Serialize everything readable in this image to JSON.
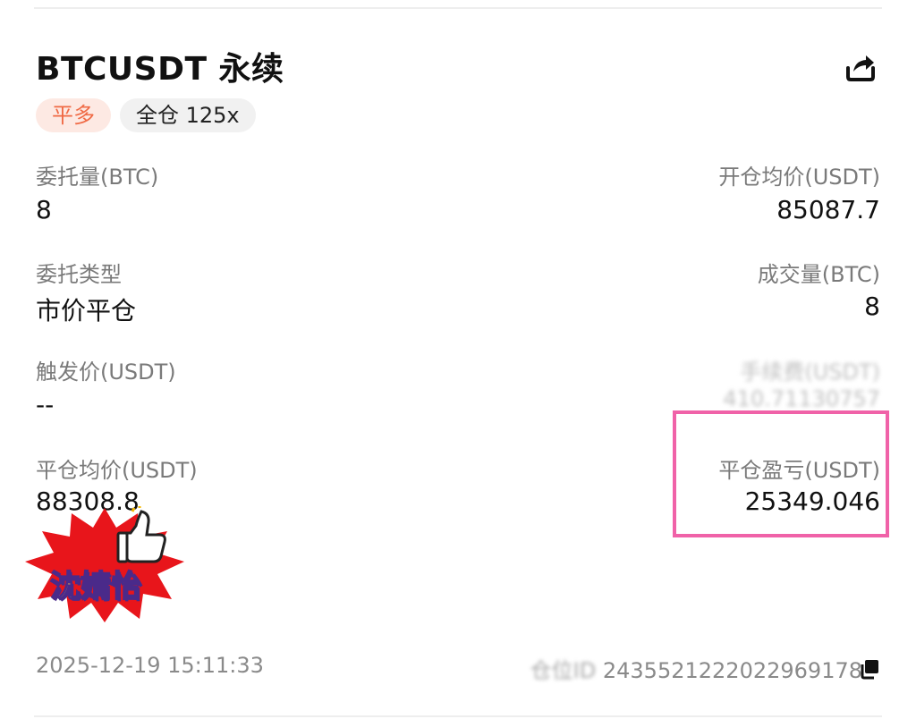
{
  "header": {
    "title": "BTCUSDT 永续",
    "badges": {
      "side": "平多",
      "margin": "全仓 125x"
    }
  },
  "fields": {
    "order_qty": {
      "label": "委托量(BTC)",
      "value": "8"
    },
    "open_avg_price": {
      "label": "开仓均价(USDT)",
      "value": "85087.7"
    },
    "order_type": {
      "label": "委托类型",
      "value": "市价平仓"
    },
    "filled_qty": {
      "label": "成交量(BTC)",
      "value": "8"
    },
    "trigger_price": {
      "label": "触发价(USDT)",
      "value": "--"
    },
    "fee": {
      "label": "手续费(USDT)",
      "value": "410.71130757"
    },
    "close_avg_price": {
      "label": "平仓均价(USDT)",
      "value": "88308.8"
    },
    "close_pnl": {
      "label": "平仓盈亏(USDT)",
      "value": "25349.046"
    }
  },
  "footer": {
    "timestamp": "2025-12-19 15:11:33",
    "position_id_label": "仓位ID",
    "position_id": "2435521222022969178"
  },
  "sticker": {
    "text": "沈婧怡"
  },
  "colors": {
    "side_badge_bg": "#fde9e3",
    "side_badge_text": "#f06a45",
    "highlight_border": "#f062a8"
  },
  "icons": {
    "share": "share-icon",
    "copy": "copy-icon",
    "thumbs_up": "thumbs-up-icon"
  }
}
